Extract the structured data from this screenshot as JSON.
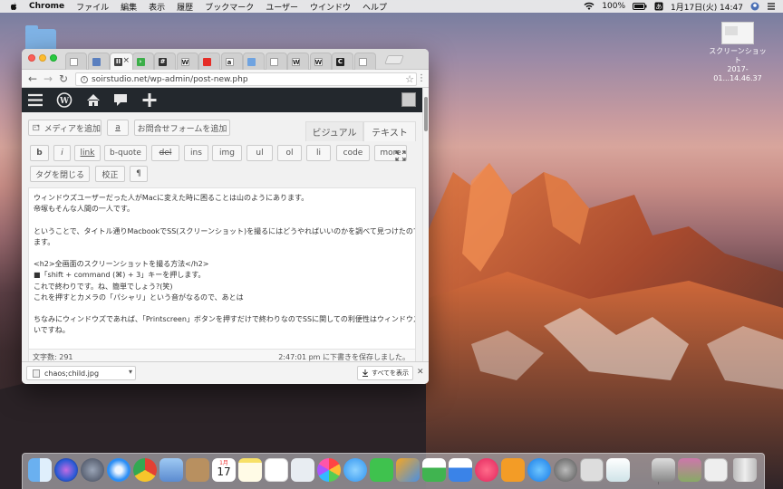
{
  "menubar": {
    "app_name": "Chrome",
    "items": [
      "ファイル",
      "編集",
      "表示",
      "履歴",
      "ブックマーク",
      "ユーザー",
      "ウインドウ",
      "ヘルプ"
    ],
    "battery": "100%",
    "clock": "1月17日(火)  14:47"
  },
  "desktop": {
    "screenshot_file_line1": "スクリーンショット",
    "screenshot_file_line2": "2017-01...14.46.37"
  },
  "browser": {
    "url": "soirstudio.net/wp-admin/post-new.php",
    "tabs": [
      {
        "favicon": "page-icon",
        "active": false
      },
      {
        "favicon": "screen-icon",
        "active": false
      },
      {
        "favicon": "pause-icon",
        "active": true
      },
      {
        "favicon": "green-arrow-icon",
        "active": false
      },
      {
        "favicon": "grid-icon",
        "active": false
      },
      {
        "favicon": "wikipedia-icon",
        "active": false
      },
      {
        "favicon": "youtube-icon",
        "active": false
      },
      {
        "favicon": "amazon-icon",
        "active": false
      },
      {
        "favicon": "doc-icon",
        "active": false
      },
      {
        "favicon": "page-icon",
        "active": false
      },
      {
        "favicon": "wikipedia-icon",
        "active": false
      },
      {
        "favicon": "wikipedia-icon",
        "active": false
      },
      {
        "favicon": "c-icon",
        "active": false
      },
      {
        "favicon": "page-icon",
        "active": false
      }
    ],
    "download": {
      "filename": "chaos;child.jpg",
      "show_all": "すべてを表示"
    }
  },
  "wp": {
    "add_media": "メディアを追加",
    "form_icon_label": "a",
    "add_form": "お問合せフォームを追加",
    "tab_visual": "ビジュアル",
    "tab_text": "テキスト",
    "quicktags": [
      "b",
      "i",
      "link",
      "b-quote",
      "del",
      "ins",
      "img",
      "ul",
      "ol",
      "li",
      "code",
      "more"
    ],
    "close_tags": "タグを閉じる",
    "proofread": "校正",
    "pilcrow": "¶",
    "content_lines": [
      "ウィンドウズユーザーだった人がMacに変えた時に困ることは山のようにあります。",
      "帝塚もそんな人間の一人です。",
      "",
      "ということで、タイトル通りMacbookでSS(スクリーンショット)を撮るにはどうやればいいのかを調べて見つけたので解説しておき",
      "ます。",
      "",
      "<h2>全画面のスクリーンショットを撮る方法</h2>",
      "■「shift + command (⌘) + 3」キーを押します。",
      "これで終わりです。ね、簡単でしょう?(笑)",
      "これを押すとカメラの「パシャリ」という音がなるので、あとは",
      "",
      "ちなみにウィンドウズであれば、「Printscreen」ボタンを押すだけで終わりなのでSSに関しての利便性はウィンドウズの方が高",
      "いですね。"
    ],
    "word_count": "文字数: 291",
    "draft_saved": "2:47:01 pm に下書きを保存しました。"
  },
  "dock": {
    "date_icon_month": "1月",
    "date_icon_day": "17"
  }
}
